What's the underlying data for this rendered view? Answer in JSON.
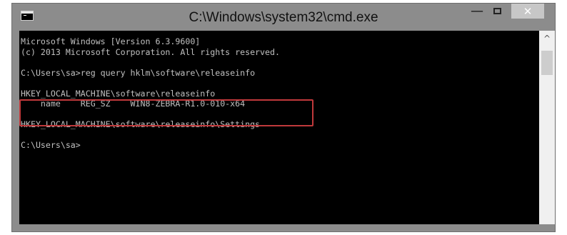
{
  "window": {
    "title": "C:\\Windows\\system32\\cmd.exe",
    "controls": {
      "minimize": "—",
      "close": "✕"
    }
  },
  "console": {
    "lines": [
      "Microsoft Windows [Version 6.3.9600]",
      "(c) 2013 Microsoft Corporation. All rights reserved.",
      "",
      "C:\\Users\\sa>reg query hklm\\software\\releaseinfo",
      "",
      "HKEY_LOCAL_MACHINE\\software\\releaseinfo",
      "    name    REG_SZ    WIN8-ZEBRA-R1.0-010-x64",
      "",
      "HKEY_LOCAL_MACHINE\\software\\releaseinfo\\Settings",
      "",
      "C:\\Users\\sa>"
    ]
  },
  "scrollbar": {
    "up_arrow": "^"
  },
  "colors": {
    "console_bg": "#000000",
    "console_text": "#c0c0c0",
    "highlight": "#c0393b",
    "frame": "#8c8c8c"
  }
}
